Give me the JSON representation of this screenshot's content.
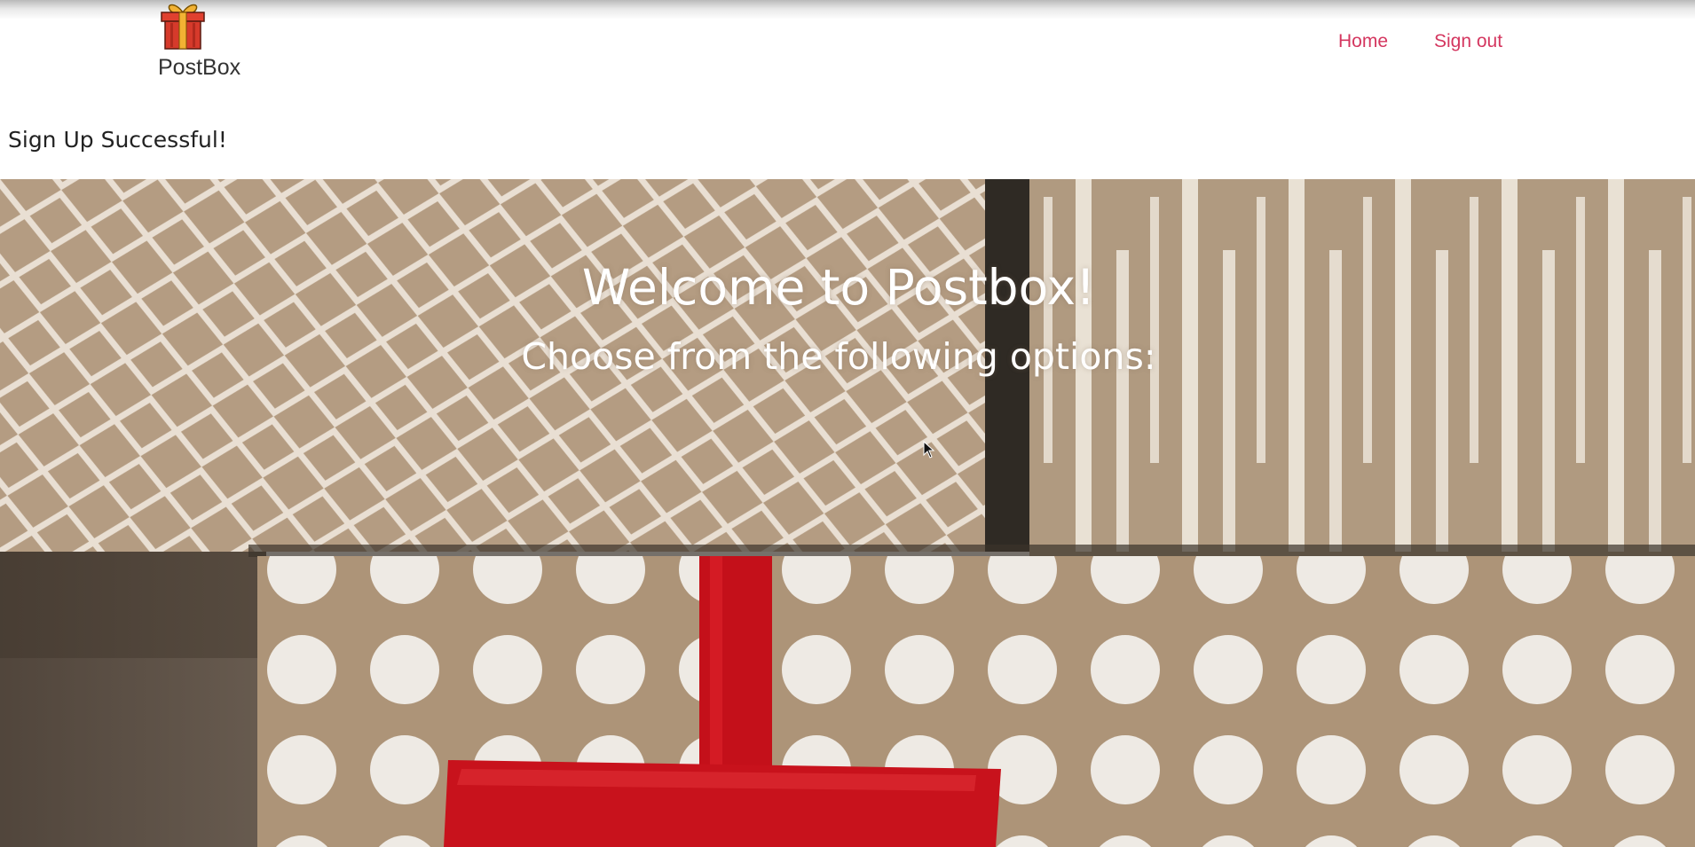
{
  "navbar": {
    "brand_name": "PostBox",
    "brand_icon": "gift-icon",
    "links": [
      {
        "label": "Home"
      },
      {
        "label": "Sign out"
      }
    ],
    "link_color": "#d4365f"
  },
  "flash": {
    "message": "Sign Up Successful!"
  },
  "hero": {
    "title": "Welcome to Postbox!",
    "subtitle": "Choose from the following options:",
    "background": "gift-wrapped-boxes-image",
    "text_color": "#ffffff"
  }
}
